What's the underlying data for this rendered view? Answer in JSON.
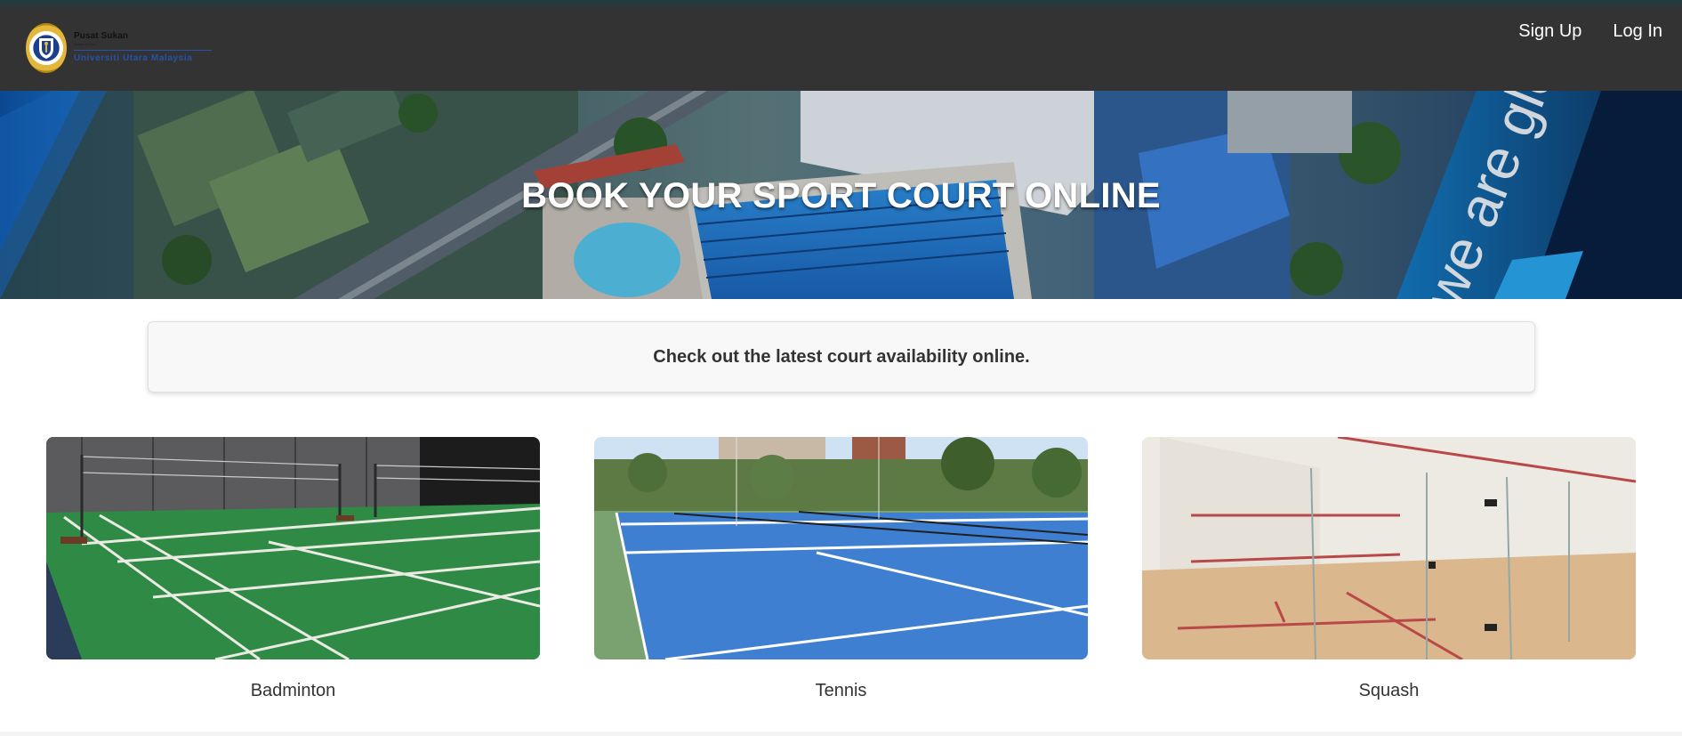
{
  "colors": {
    "navbar_bg": "#333333",
    "top_strip": "#243a3c",
    "brand_blue": "#2752a8",
    "notice_bg": "#f8f8f8",
    "text": "#333333"
  },
  "brand": {
    "logo_icon": "uum-seal-logo",
    "line1": "Pusat Sukan",
    "line2": "Sports Centre",
    "line3": "Universiti Utara Malaysia"
  },
  "nav": {
    "signup_label": "Sign Up",
    "login_label": "Log In"
  },
  "hero": {
    "title": "BOOK YOUR SPORT COURT ONLINE",
    "watermark": "we are glo"
  },
  "notice": {
    "text": "Check out the latest court availability online."
  },
  "sports": [
    {
      "name": "Badminton",
      "image": "badminton-court-photo"
    },
    {
      "name": "Tennis",
      "image": "tennis-court-photo"
    },
    {
      "name": "Squash",
      "image": "squash-court-photo"
    }
  ]
}
